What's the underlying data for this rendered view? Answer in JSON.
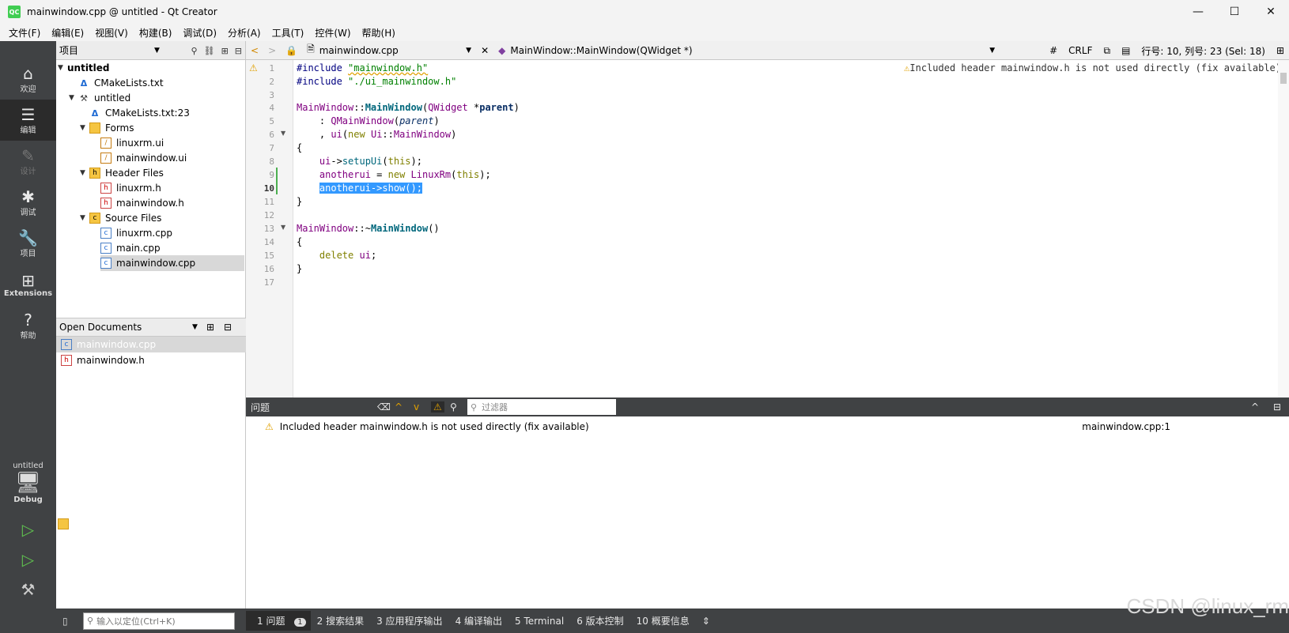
{
  "window": {
    "title": "mainwindow.cpp @ untitled - Qt Creator",
    "app_icon": "QC"
  },
  "menu": [
    "文件(F)",
    "编辑(E)",
    "视图(V)",
    "构建(B)",
    "调试(D)",
    "分析(A)",
    "工具(T)",
    "控件(W)",
    "帮助(H)"
  ],
  "modes": [
    {
      "label": "欢迎",
      "icon": "⌂"
    },
    {
      "label": "编辑",
      "icon": "☰"
    },
    {
      "label": "设计",
      "icon": "✎"
    },
    {
      "label": "调试",
      "icon": "✱"
    },
    {
      "label": "项目",
      "icon": "🔧"
    },
    {
      "label": "Extensions",
      "icon": "⊞"
    },
    {
      "label": "帮助",
      "icon": "?"
    }
  ],
  "kit": {
    "project": "untitled",
    "config": "Debug"
  },
  "projects_pane": {
    "title": "项目",
    "tree": [
      {
        "label": "untitled",
        "type": "proj"
      },
      {
        "label": "CMakeLists.txt",
        "type": "cmake"
      },
      {
        "label": "untitled",
        "type": "target"
      },
      {
        "label": "CMakeLists.txt:23",
        "type": "cmake"
      },
      {
        "label": "Forms",
        "type": "folder"
      },
      {
        "label": "linuxrm.ui",
        "type": "ui"
      },
      {
        "label": "mainwindow.ui",
        "type": "ui"
      },
      {
        "label": "Header Files",
        "type": "folder"
      },
      {
        "label": "linuxrm.h",
        "type": "h"
      },
      {
        "label": "mainwindow.h",
        "type": "h"
      },
      {
        "label": "Source Files",
        "type": "folder"
      },
      {
        "label": "linuxrm.cpp",
        "type": "cpp"
      },
      {
        "label": "main.cpp",
        "type": "cpp"
      },
      {
        "label": "mainwindow.cpp",
        "type": "cpp"
      }
    ]
  },
  "open_documents": {
    "title": "Open Documents",
    "docs": [
      "mainwindow.cpp",
      "mainwindow.h"
    ]
  },
  "locator": {
    "placeholder": "输入以定位(Ctrl+K)"
  },
  "editor": {
    "file": "mainwindow.cpp",
    "symbol": "MainWindow::MainWindow(QWidget *)",
    "encoding_label": "#",
    "line_ending": "CRLF",
    "position": "行号: 10, 列号: 23 (Sel: 18)",
    "warning": "Included header mainwindow.h is not used directly (fix available)",
    "line_numbers": [
      "1",
      "2",
      "3",
      "4",
      "5",
      "6",
      "7",
      "8",
      "9",
      "10",
      "11",
      "12",
      "13",
      "14",
      "15",
      "16",
      "17"
    ]
  },
  "issues": {
    "title": "问题",
    "filter_placeholder": "过滤器",
    "items": [
      {
        "text": "Included header mainwindow.h is not used directly (fix available)",
        "location": "mainwindow.cpp:1"
      }
    ]
  },
  "output_tabs": [
    "1 问题",
    "2 搜索结果",
    "3 应用程序输出",
    "4 编译输出",
    "5 Terminal",
    "6 版本控制",
    "10 概要信息"
  ],
  "issue_badge": "1",
  "watermark": "CSDN @linux_rm"
}
